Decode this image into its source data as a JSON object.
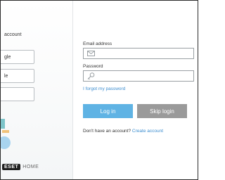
{
  "left": {
    "title_fragment": "account",
    "buttons": [
      "gle",
      "le",
      ""
    ],
    "logo": {
      "brand": "ESET",
      "product": "HOME"
    }
  },
  "form": {
    "email_label": "Email address",
    "email_value": "",
    "password_label": "Password",
    "password_value": "",
    "forgot_link": "I forgot my password",
    "login_button": "Log in",
    "skip_button": "Skip login",
    "signup_prompt": "Don't have an account?",
    "signup_link": "Create account"
  },
  "colors": {
    "primary": "#5fb3e4",
    "secondary": "#9a9a9a",
    "link": "#3a8ccf"
  },
  "icons": {
    "email": "envelope-icon",
    "password": "key-icon"
  }
}
